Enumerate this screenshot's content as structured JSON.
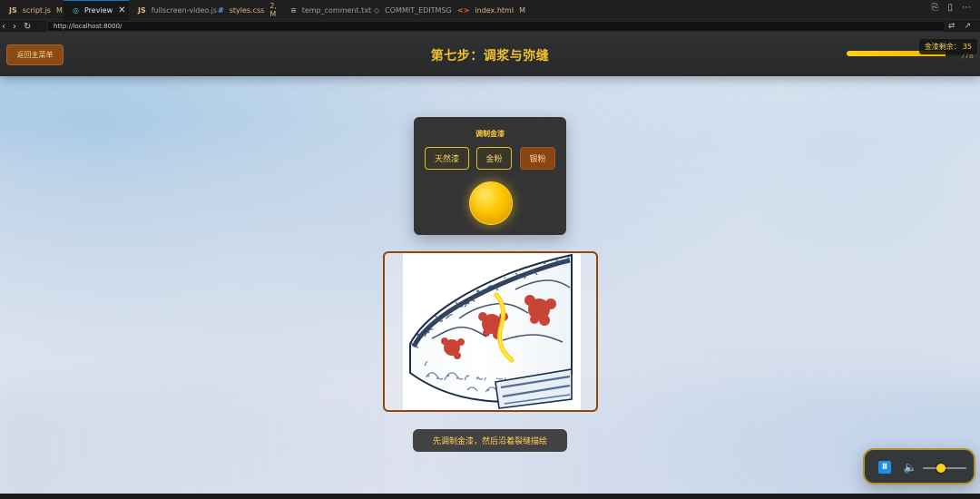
{
  "editor": {
    "tabs": [
      {
        "icon": "JS",
        "label": "script.js",
        "badge": "M",
        "modified": true,
        "active": false
      },
      {
        "icon": "◎",
        "label": "Preview",
        "badge": "",
        "modified": false,
        "active": true,
        "close": "✕"
      },
      {
        "icon": "JS",
        "label": "fullscreen-video.js",
        "badge": "",
        "modified": false,
        "active": false
      },
      {
        "icon": "#",
        "label": "styles.css",
        "badge": "2, M",
        "modified": true,
        "active": false
      },
      {
        "icon": "≡",
        "label": "temp_comment.txt",
        "badge": "",
        "modified": false,
        "active": false
      },
      {
        "icon": "◇",
        "label": "COMMIT_EDITMSG",
        "badge": "",
        "modified": false,
        "active": false
      },
      {
        "icon": "<>",
        "label": "index.html",
        "badge": "M",
        "modified": true,
        "active": false
      }
    ],
    "right_icons": [
      "⎘",
      "▯",
      "⋯"
    ]
  },
  "browser": {
    "nav": [
      "‹",
      "›",
      "↻"
    ],
    "url": "http://localhost:8000/",
    "right_icons": [
      "⇄",
      "↗"
    ]
  },
  "app": {
    "back_button": "返回主菜单",
    "title": "第七步：调浆与弥缝",
    "progress": {
      "fraction": 0.78,
      "text": "/78"
    },
    "remaining": {
      "label": "金漆剩余：",
      "value": "35"
    },
    "panel": {
      "title": "调制金漆",
      "buttons": [
        {
          "label": "天然漆",
          "style": "outline"
        },
        {
          "label": "金粉",
          "style": "outline"
        },
        {
          "label": "银粉",
          "style": "filled"
        }
      ]
    },
    "hint": "先调制金漆，然后沿着裂缝描绘",
    "music": {
      "play_glyph": "Ⅱ",
      "volume_glyph": "🔈",
      "volume": 0.4
    }
  },
  "colors": {
    "accent_gold": "#F3C12B",
    "button_brown": "#8B4A14",
    "panel_dark": "#2C2B2B",
    "play_blue": "#1F8FE6"
  }
}
